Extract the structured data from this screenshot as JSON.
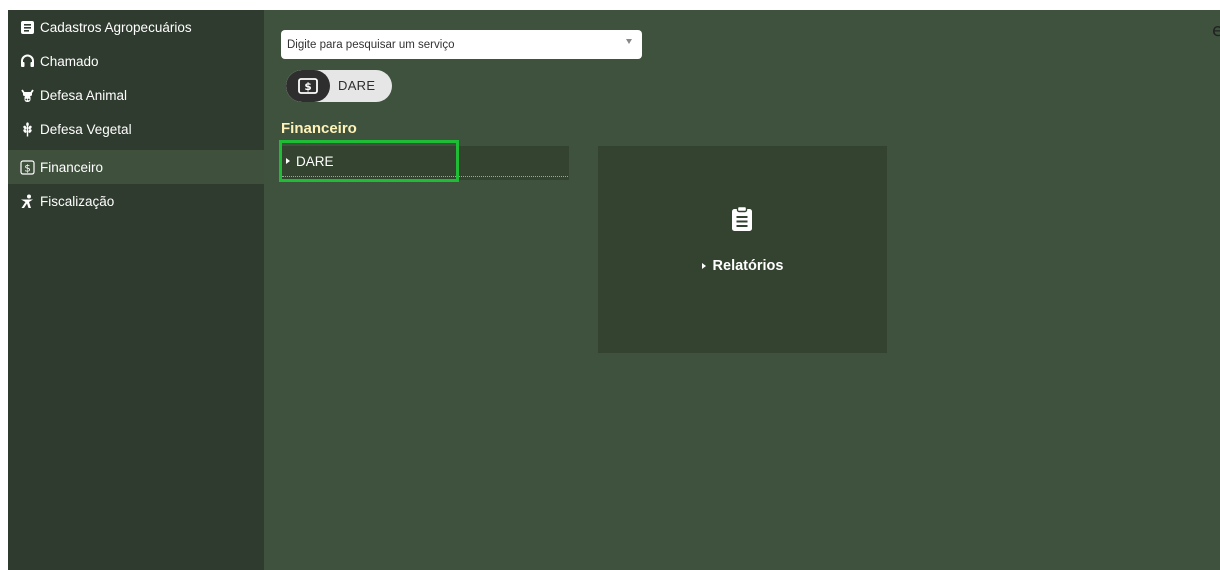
{
  "sidebar": {
    "items": [
      {
        "label": "Cadastros Agropecuários",
        "icon": "list-icon"
      },
      {
        "label": "Chamado",
        "icon": "headset-icon"
      },
      {
        "label": "Defesa Animal",
        "icon": "cow-icon"
      },
      {
        "label": "Defesa Vegetal",
        "icon": "wheat-icon"
      },
      {
        "label": "Financeiro",
        "icon": "dollar-icon",
        "active": true
      },
      {
        "label": "Fiscalização",
        "icon": "inspector-icon"
      }
    ]
  },
  "search": {
    "placeholder": "Digite para pesquisar um serviço"
  },
  "shortcut": {
    "label": "DARE",
    "icon": "dollar-bill-icon"
  },
  "section": {
    "title": "Financeiro",
    "items": [
      {
        "label": "DARE"
      }
    ]
  },
  "card": {
    "label": "Relatórios",
    "icon": "clipboard-icon"
  },
  "edge": {
    "glyph": "e"
  },
  "colors": {
    "sidebar_bg": "#2f3b2e",
    "sidebar_active": "#3f513d",
    "main_bg": "#3e523e",
    "panel_bg": "#33432f",
    "title_color": "#fff3b8",
    "highlight": "#1ebd35"
  }
}
